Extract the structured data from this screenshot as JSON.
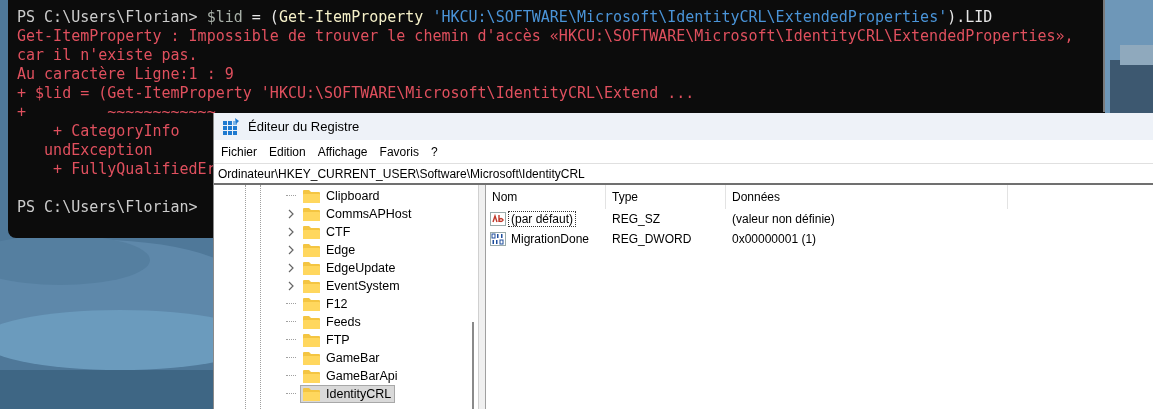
{
  "terminal": {
    "lines": [
      [
        {
          "kind": "prompt",
          "text": "PS C:\\Users\\Florian> "
        },
        {
          "kind": "variable",
          "text": "$lid"
        },
        {
          "kind": "plain",
          "text": " = ("
        },
        {
          "kind": "command",
          "text": "Get-ItemProperty"
        },
        {
          "kind": "string",
          "text": " 'HKCU:\\SOFTWARE\\Microsoft\\IdentityCRL\\ExtendedProperties'"
        },
        {
          "kind": "plain",
          "text": ").LID"
        }
      ],
      [
        {
          "kind": "error",
          "text": "Get-ItemProperty : Impossible de trouver le chemin d'accès «HKCU:\\SOFTWARE\\Microsoft\\IdentityCRL\\ExtendedProperties»,"
        }
      ],
      [
        {
          "kind": "error",
          "text": "car il n'existe pas."
        }
      ],
      [
        {
          "kind": "error",
          "text": "Au caractère Ligne:1 : 9"
        }
      ],
      [
        {
          "kind": "error",
          "text": "+ $lid = (Get-ItemProperty 'HKCU:\\SOFTWARE\\Microsoft\\IdentityCRL\\Extend ..."
        }
      ],
      [
        {
          "kind": "error",
          "text": "+         ~~~~~~~~~~~~"
        }
      ],
      [
        {
          "kind": "error",
          "text": "    + CategoryInfo"
        }
      ],
      [
        {
          "kind": "error",
          "text": "   undException"
        }
      ],
      [
        {
          "kind": "error",
          "text": "    + FullyQualifiedEr"
        }
      ]
    ],
    "current_prompt": "PS C:\\Users\\Florian>"
  },
  "registry": {
    "title": "Éditeur du Registre",
    "menu": [
      "Fichier",
      "Edition",
      "Affichage",
      "Favoris",
      "?"
    ],
    "address": "Ordinateur\\HKEY_CURRENT_USER\\Software\\Microsoft\\IdentityCRL",
    "tree": [
      {
        "label": "Clipboard",
        "expandable": false,
        "selected": false
      },
      {
        "label": "CommsAPHost",
        "expandable": true,
        "selected": false
      },
      {
        "label": "CTF",
        "expandable": true,
        "selected": false
      },
      {
        "label": "Edge",
        "expandable": true,
        "selected": false
      },
      {
        "label": "EdgeUpdate",
        "expandable": true,
        "selected": false
      },
      {
        "label": "EventSystem",
        "expandable": true,
        "selected": false
      },
      {
        "label": "F12",
        "expandable": false,
        "selected": false
      },
      {
        "label": "Feeds",
        "expandable": false,
        "selected": false
      },
      {
        "label": "FTP",
        "expandable": false,
        "selected": false
      },
      {
        "label": "GameBar",
        "expandable": false,
        "selected": false
      },
      {
        "label": "GameBarApi",
        "expandable": false,
        "selected": false
      },
      {
        "label": "IdentityCRL",
        "expandable": false,
        "selected": true
      }
    ],
    "columns": [
      "Nom",
      "Type",
      "Données"
    ],
    "values": [
      {
        "kind": "string",
        "name": "(par défaut)",
        "type": "REG_SZ",
        "data": "(valeur non définie)",
        "focused": true
      },
      {
        "kind": "binary",
        "name": "MigrationDone",
        "type": "REG_DWORD",
        "data": "0x00000001 (1)",
        "focused": false
      }
    ]
  }
}
